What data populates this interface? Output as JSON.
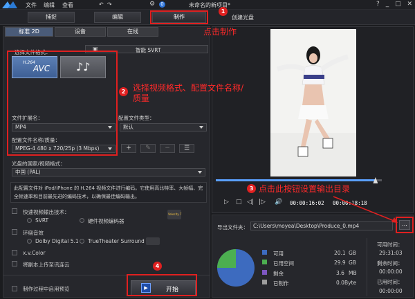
{
  "menu": {
    "file": "文件",
    "edit": "编辑",
    "view": "查看",
    "window_title": "未命名的新项目*",
    "help": "?"
  },
  "modes": {
    "capture": "捕捉",
    "edit": "编辑",
    "produce": "制作",
    "disc": "创建光盘"
  },
  "subtabs": {
    "standard2d": "标准 2D",
    "device": "设备",
    "online": "在线"
  },
  "format": {
    "label": "选择文件格式：",
    "smart_svrt": "智能 SVRT",
    "h264_label": "H.264",
    "avc_label": "AVC"
  },
  "ext": {
    "label": "文件扩展名：",
    "value": "MP4"
  },
  "profile_type": {
    "label": "配置文件类型：",
    "value": "默认"
  },
  "profile": {
    "label": "配置文件名称/质量：",
    "value": "MPEG-4 480 x 720/25p (3 Mbps)"
  },
  "region": {
    "label": "光盘的国家/视频格式：",
    "value": "中国 (PAL)"
  },
  "description": "此配置文件对 iPod/iPhone 的 H.264 视频文件进行编码。它使用高比特率、大帧幅、完全帧速率和目前最先进的编码技术，以确保最佳编码输出。",
  "options": {
    "fast_render": "快速视频输出技术：",
    "svrt": "SVRT",
    "hw_encoder": "硬件视频编码器",
    "surround": "环绕音效",
    "dolby": "Dolby Digital 5.1",
    "truetheater": "TrueTheater Surround",
    "xvcolor": "x.v.Color",
    "upload": "将副本上传至讯连云",
    "preview": "制作过程中启用预览",
    "velocity": "Velocity 7"
  },
  "start_button": "开始",
  "player": {
    "current_time": "00:00:16:02",
    "total_time": "00:00:18:18",
    "progress": 0.96
  },
  "output": {
    "label": "导出文件夹：",
    "path": "C:\\Users\\moyea\\Desktop\\Produce_0.mp4",
    "browse": "..."
  },
  "disk": {
    "available": {
      "label": "可用",
      "value": "20.1",
      "unit": "GB",
      "color": "#3d6bbf"
    },
    "used": {
      "label": "已用空间",
      "value": "29.9",
      "unit": "GB",
      "color": "#4caf50"
    },
    "remaining": {
      "label": "剩余",
      "value": "3.6",
      "unit": "MB",
      "color": "#7e57c2"
    },
    "produced": {
      "label": "已制作",
      "value": "0.0",
      "unit": "Byte",
      "color": "#9e9e9e"
    }
  },
  "times": {
    "available_label": "可用时间：",
    "available": "29:31:03",
    "remaining_label": "剩余时间：",
    "remaining": "00:00:00",
    "elapsed_label": "已用时间：",
    "elapsed": "00:00:00"
  },
  "annotations": {
    "a1": "点击制作",
    "a2": "选择视频格式、配置文件名称/质量",
    "a3": "点击此按钮设置输出目录",
    "n1": "1",
    "n2": "2",
    "n3": "3",
    "n4": "4"
  }
}
